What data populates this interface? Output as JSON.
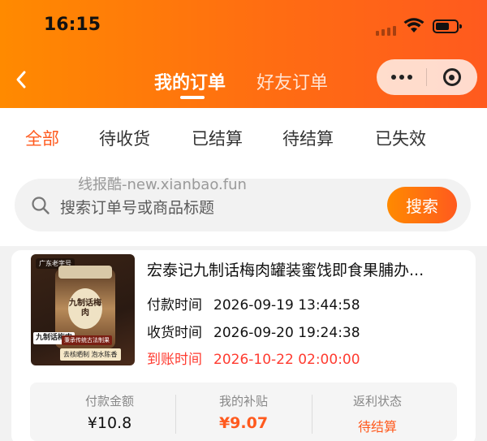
{
  "status_bar": {
    "time": "16:15"
  },
  "header": {
    "tabs": [
      {
        "label": "我的订单",
        "active": true
      },
      {
        "label": "好友订单",
        "active": false
      }
    ],
    "accent_color": "#ff6d12"
  },
  "filters": {
    "tabs": [
      {
        "label": "全部",
        "active": true
      },
      {
        "label": "待收货",
        "active": false
      },
      {
        "label": "已结算",
        "active": false
      },
      {
        "label": "待结算",
        "active": false
      },
      {
        "label": "已失效",
        "active": false
      }
    ]
  },
  "watermark": "线报酷-new.xianbao.fun",
  "search": {
    "placeholder": "搜索订单号或商品标题",
    "button_label": "搜索"
  },
  "order": {
    "image": {
      "brand_tag": "广东老字号",
      "jar_label": "九制话梅肉",
      "left_tag": "九制话梅肉",
      "strip1": "秉承传统古法制果",
      "strip2": "去核晒制 泡水陈香"
    },
    "title": "宏泰记九制话梅肉罐装蜜饯即食果脯办...",
    "rows": [
      {
        "label": "付款时间",
        "value": "2026-09-19 13:44:58",
        "highlight": false
      },
      {
        "label": "收货时间",
        "value": "2026-09-20 19:24:38",
        "highlight": false
      },
      {
        "label": "到账时间",
        "value": "2026-10-22 02:00:00",
        "highlight": true
      }
    ],
    "stats": {
      "paid": {
        "label": "付款金额",
        "value": "¥10.8"
      },
      "subsidy": {
        "label": "我的补贴",
        "value": "¥9.07"
      },
      "status": {
        "label": "返利状态",
        "value": "待结算"
      }
    }
  }
}
